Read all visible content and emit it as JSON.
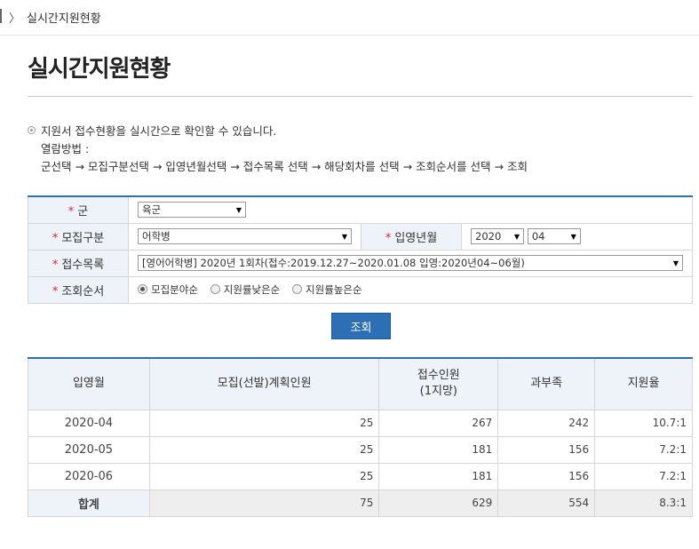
{
  "breadcrumb": {
    "current": "실시간지원현황"
  },
  "page": {
    "title": "실시간지원현황"
  },
  "info": {
    "line1": "지원서 접수현황을 실시간으로 확인할 수 있습니다.",
    "line2": "열람방법 :",
    "line3": "군선택 → 모집구분선택 → 입영년월선택 → 접수목록 선택 → 해당회차를 선택 → 조회순서를 선택 → 조회"
  },
  "form": {
    "required_mark": "*",
    "army_label": "군",
    "army_value": "육군",
    "recruit_label": "모집구분",
    "recruit_value": "어학병",
    "enlist_label": "입영년월",
    "year_value": "2020",
    "month_value": "04",
    "list_label": "접수목록",
    "list_value": "[영어어학병] 2020년 1회차(접수:2019.12.27~2020.01.08 입영:2020년04~06월)",
    "order_label": "조회순서",
    "order_options": [
      "모집분야순",
      "지원률낮은순",
      "지원률높은순"
    ],
    "order_selected_index": 0
  },
  "search_button": "조회",
  "results": {
    "headers": [
      "입영월",
      "모집(선발)계획인원",
      "접수인원",
      "(1지망)",
      "과부족",
      "지원율"
    ],
    "rows": [
      [
        "2020-04",
        "25",
        "267",
        "242",
        "10.7:1"
      ],
      [
        "2020-05",
        "25",
        "181",
        "156",
        "7.2:1"
      ],
      [
        "2020-06",
        "25",
        "181",
        "156",
        "7.2:1"
      ]
    ],
    "total": [
      "합계",
      "75",
      "629",
      "554",
      "8.3:1"
    ]
  },
  "colors": {
    "accent": "#2c6fb5",
    "required": "#d9232d",
    "header_bg": "#eef3f9"
  }
}
